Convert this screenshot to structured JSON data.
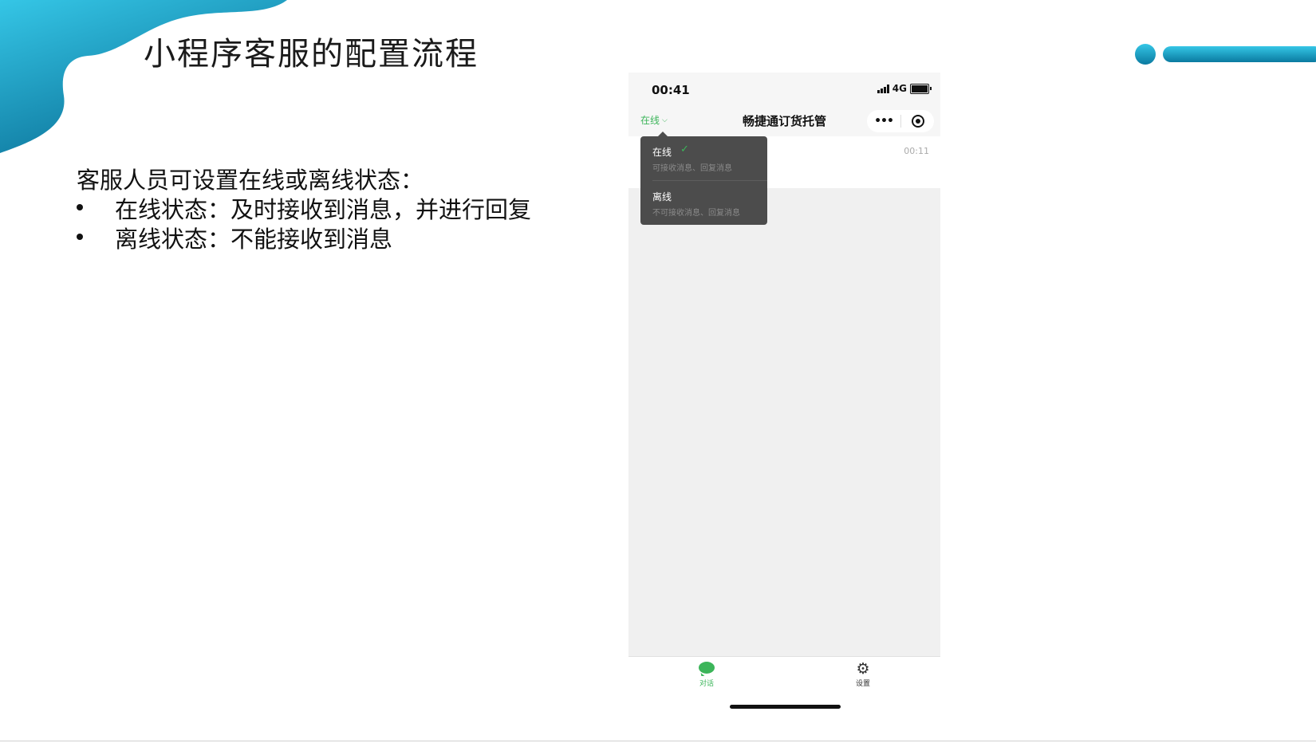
{
  "slide": {
    "title": "小程序客服的配置流程",
    "intro": "客服人员可设置在线或离线状态：",
    "bullets": [
      "在线状态：及时接收到消息，并进行回复",
      "离线状态：不能接收到消息"
    ]
  },
  "phone": {
    "status_bar": {
      "time": "00:41",
      "network": "4G"
    },
    "nav": {
      "status_toggle": "在线",
      "title": "畅捷通订货托管",
      "more_icon": "more-dots-icon",
      "close_icon": "capsule-close-icon"
    },
    "conversation": {
      "time": "00:11"
    },
    "dropdown": {
      "options": [
        {
          "label": "在线",
          "desc": "可接收消息、回复消息",
          "selected": true
        },
        {
          "label": "离线",
          "desc": "不可接收消息、回复消息",
          "selected": false
        }
      ]
    },
    "tabs": [
      {
        "label": "对话",
        "icon": "chat-bubble-icon",
        "active": true
      },
      {
        "label": "设置",
        "icon": "gear-icon",
        "active": false
      }
    ]
  },
  "colors": {
    "accent_green": "#3cb55a",
    "deco_blue": "#1fb4d6",
    "deco_dark_blue": "#0a6f96",
    "dropdown_bg": "#4c4c4c"
  }
}
